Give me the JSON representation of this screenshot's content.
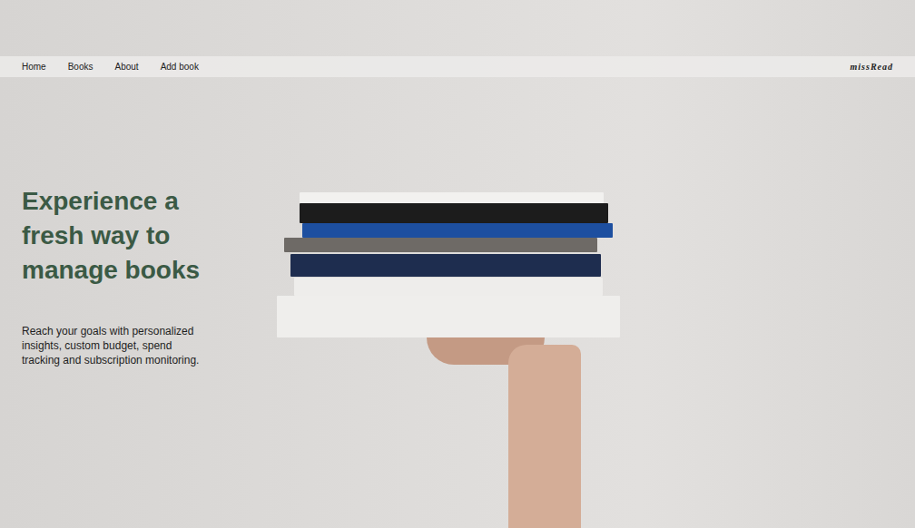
{
  "nav": {
    "links": [
      "Home",
      "Books",
      "About",
      "Add book"
    ],
    "logo": "missRead"
  },
  "hero": {
    "title_lines": [
      "Experience a",
      "fresh way to",
      "manage books"
    ],
    "text_lines": [
      "Reach your goals with personalized",
      "insights, custom budget, spend",
      "tracking and subscription monitoring."
    ]
  }
}
